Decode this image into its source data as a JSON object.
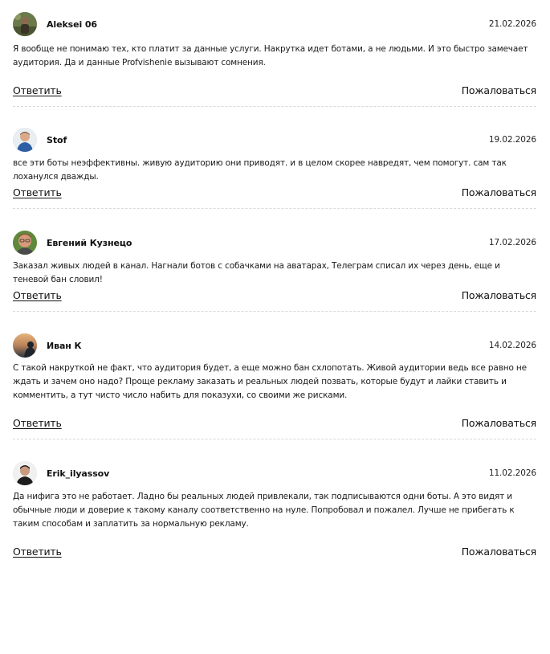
{
  "comments": [
    {
      "author": "Aleksei 06",
      "date": "21.02.2026",
      "text": "Я вообще не понимаю тех, кто платит за данные услуги. Накрутка идет ботами, а не людьми. И это быстро замечает аудитория. Да и данные Profvishenie вызывают сомнения.",
      "reply_label": "Ответить",
      "report_label": "Пожаловаться",
      "avatar": "avatar-photo-outdoor"
    },
    {
      "author": "Stof",
      "date": "19.02.2026",
      "text": "все эти боты неэффективны. живую аудиторию они приводят. и в целом скорее навредят, чем помогут. сам так лоханулся дважды.",
      "reply_label": "Ответить",
      "report_label": "Пожаловаться",
      "avatar": "avatar-photo-man-blue"
    },
    {
      "author": "Евгений Кузнецо",
      "date": "17.02.2026",
      "text": "Заказал живых людей в канал. Нагнали ботов с собачками на аватарах, Телеграм списал их через день, еще и теневой бан словил!",
      "reply_label": "Ответить",
      "report_label": "Пожаловаться",
      "avatar": "avatar-photo-man-glasses"
    },
    {
      "author": "Иван К",
      "date": "14.02.2026",
      "text": "С такой накруткой не факт, что аудитория будет, а еще можно бан схлопотать. Живой аудитории ведь все равно не ждать и зачем оно надо? Проще рекламу заказать и реальных людей позвать, которые будут и лайки ставить и комментить, а тут чисто число набить для показухи, со своими же рисками.",
      "reply_label": "Ответить",
      "report_label": "Пожаловаться",
      "avatar": "avatar-photo-sunset"
    },
    {
      "author": "Erik_ilyassov",
      "date": "11.02.2026",
      "text": "Да нифига это не работает. Ладно бы реальных людей привлекали, так подписываются одни боты. А это видят и обычные люди и доверие к такому каналу соответственно на нуле. Попробовал и пожалел. Лучше не прибегать к таким способам и заплатить за нормальную рекламу.",
      "reply_label": "Ответить",
      "report_label": "Пожаловаться",
      "avatar": "avatar-photo-man-dark"
    }
  ]
}
